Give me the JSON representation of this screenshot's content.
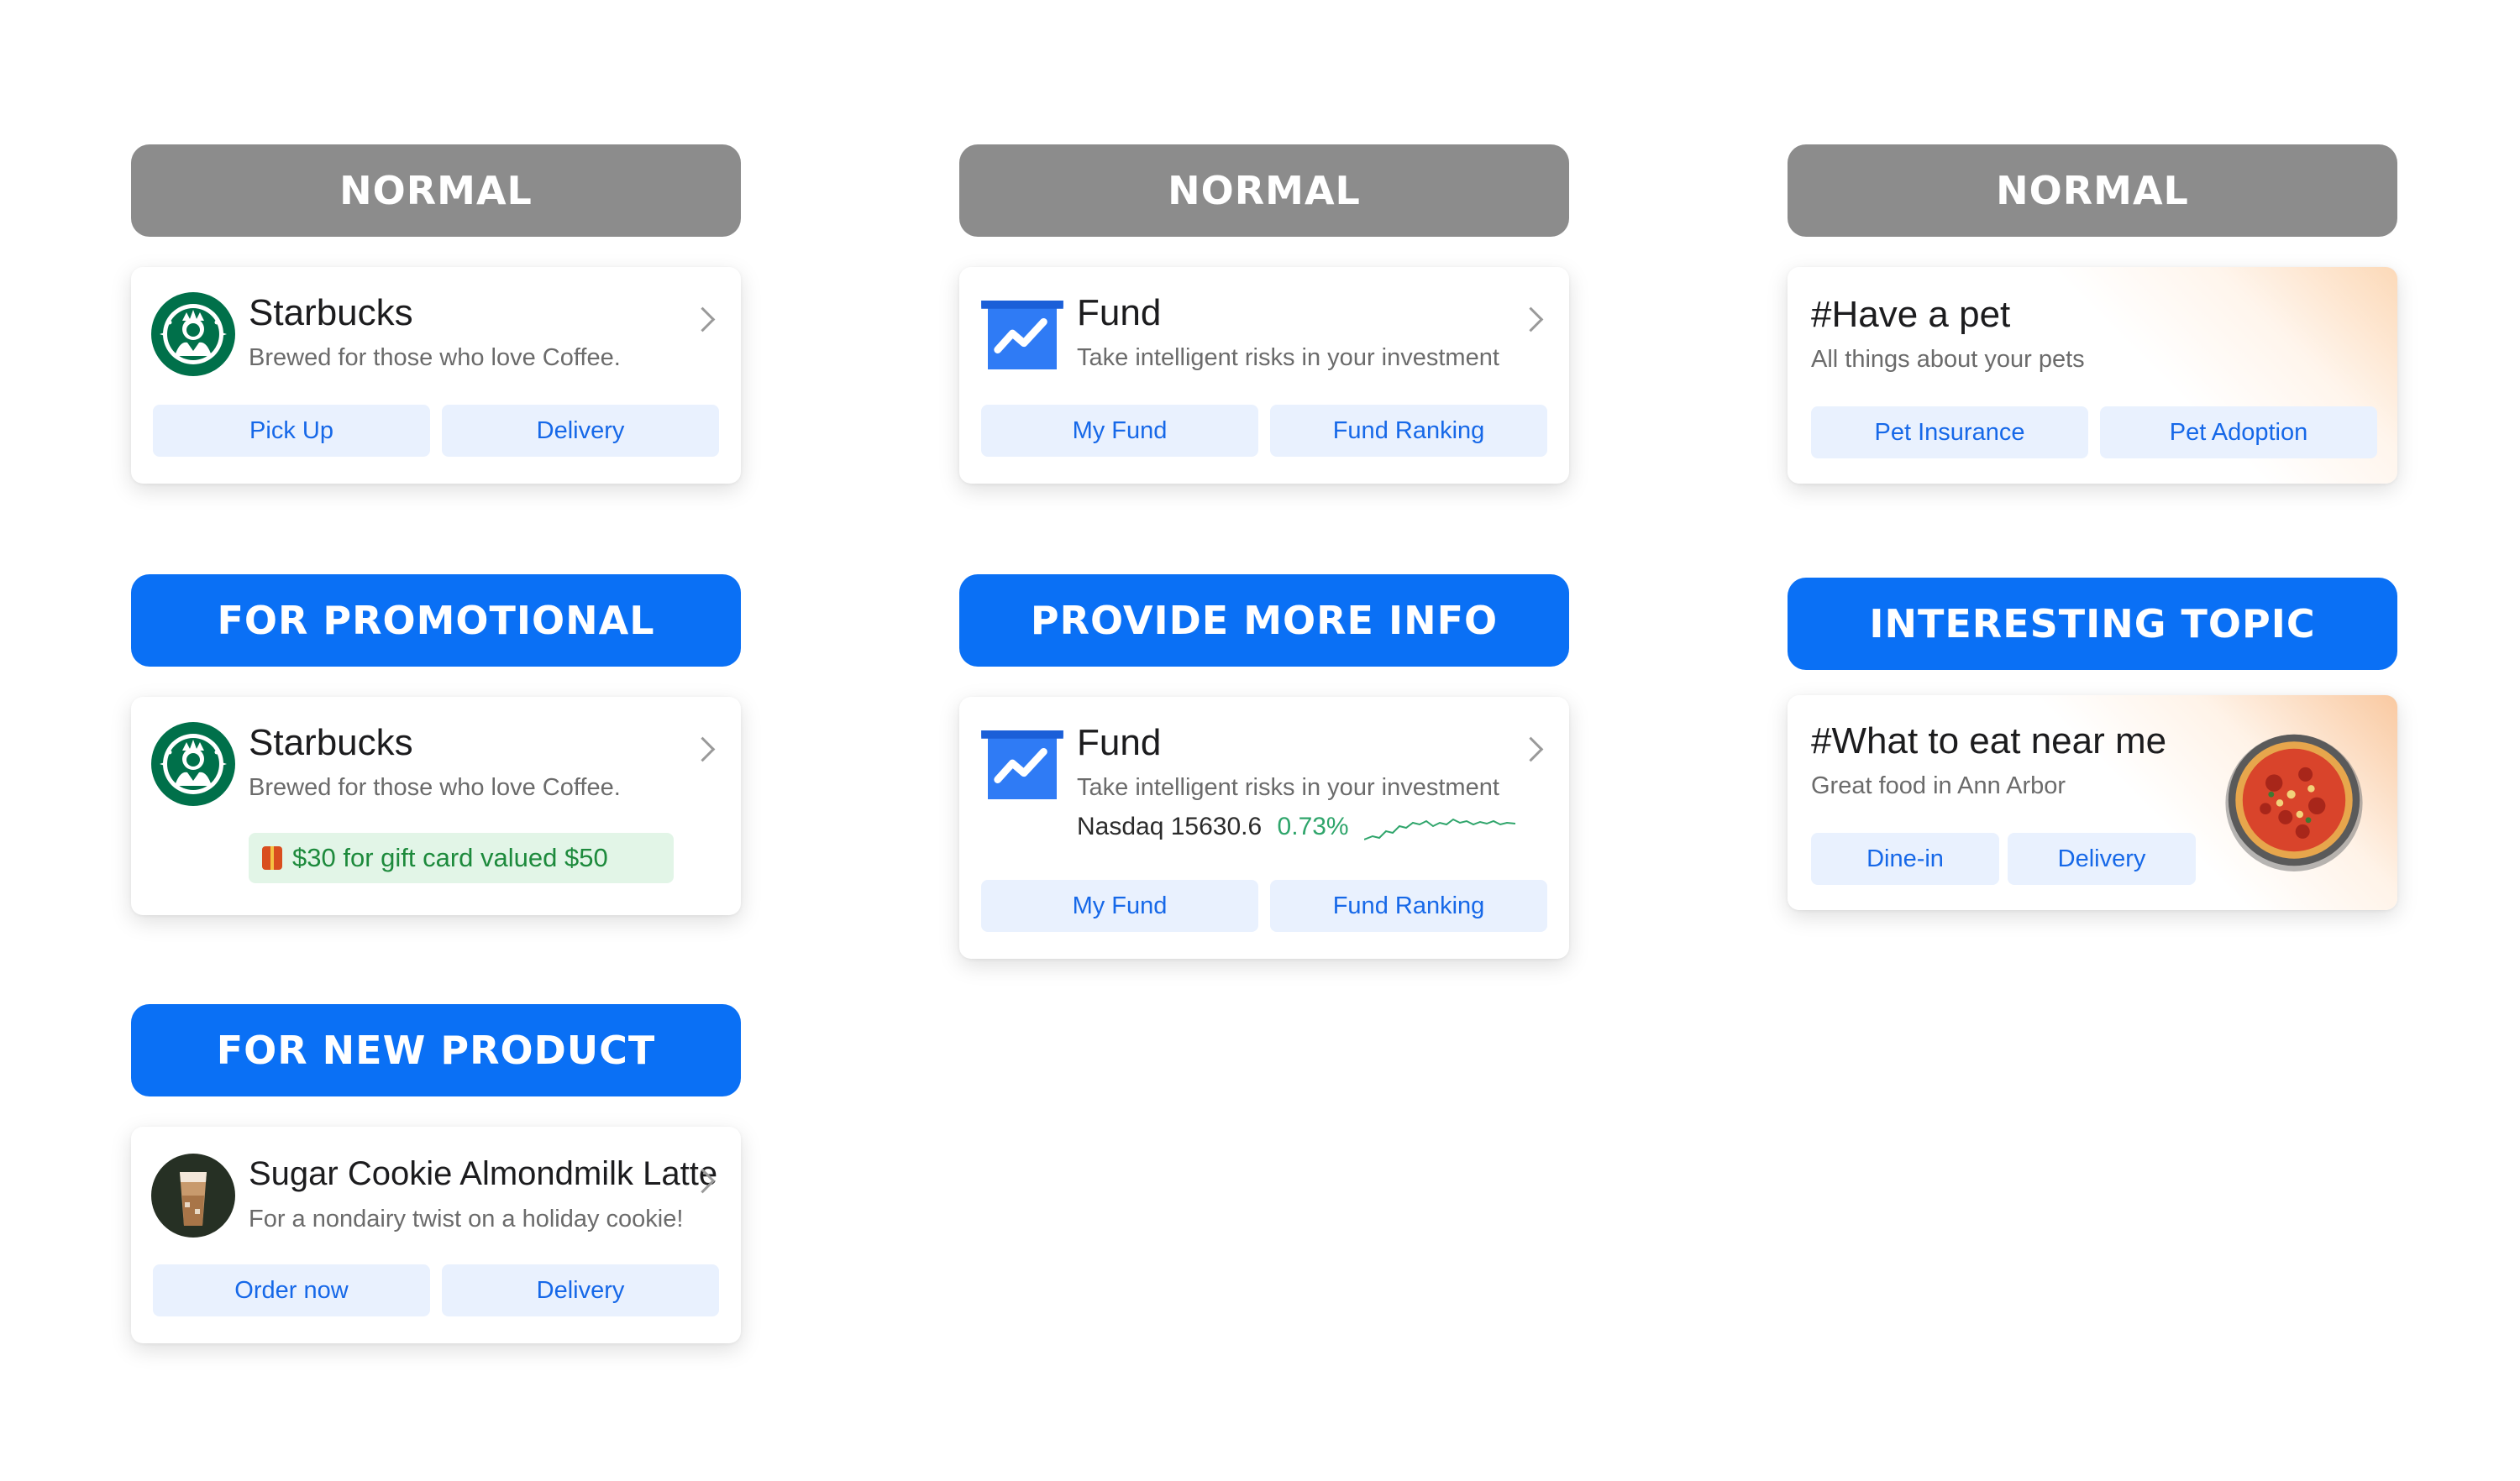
{
  "colors": {
    "label_normal": "#8c8c8c",
    "label_highlight": "#0a70f5",
    "button_bg": "#e9f1fe",
    "button_text": "#1668e8",
    "promo_bg": "#e2f5e7",
    "promo_text": "#1d8a3c",
    "positive": "#2fa56b"
  },
  "columns": [
    {
      "sections": [
        {
          "label": "NORMAL",
          "card": {
            "icon": "starbucks-logo",
            "title": "Starbucks",
            "subtitle": "Brewed for those who love Coffee.",
            "buttons": [
              "Pick Up",
              "Delivery"
            ]
          }
        },
        {
          "label": "FOR PROMOTIONAL",
          "card": {
            "icon": "starbucks-logo",
            "title": "Starbucks",
            "subtitle": "Brewed for those who love Coffee.",
            "promo": {
              "icon": "gift-icon",
              "text": "$30 for gift card valued $50"
            }
          }
        },
        {
          "label": "FOR NEW PRODUCT",
          "card": {
            "icon": "latte-image",
            "title": "Sugar Cookie Almondmilk Latte",
            "subtitle": "For a nondairy twist on a holiday cookie!",
            "buttons": [
              "Order now",
              "Delivery"
            ]
          }
        }
      ]
    },
    {
      "sections": [
        {
          "label": "NORMAL",
          "card": {
            "icon": "fund-chart-icon",
            "title": "Fund",
            "subtitle": "Take intelligent risks in your investment",
            "buttons": [
              "My Fund",
              "Fund Ranking"
            ]
          }
        },
        {
          "label": "PROVIDE MORE INFO",
          "card": {
            "icon": "fund-chart-icon",
            "title": "Fund",
            "subtitle": "Take intelligent risks in your investment",
            "stock": {
              "name": "Nasdaq",
              "value": "15630.6",
              "change": "0.73%"
            },
            "buttons": [
              "My Fund",
              "Fund Ranking"
            ]
          }
        }
      ]
    },
    {
      "sections": [
        {
          "label": "NORMAL",
          "card": {
            "title": "#Have a pet",
            "subtitle": "All things about your pets",
            "buttons": [
              "Pet Insurance",
              "Pet Adoption"
            ]
          }
        },
        {
          "label": "INTERESTING TOPIC",
          "card": {
            "icon": "pizza-image",
            "title": "#What to eat near me",
            "subtitle": "Great food in Ann Arbor",
            "buttons": [
              "Dine-in",
              "Delivery"
            ]
          }
        }
      ]
    }
  ]
}
